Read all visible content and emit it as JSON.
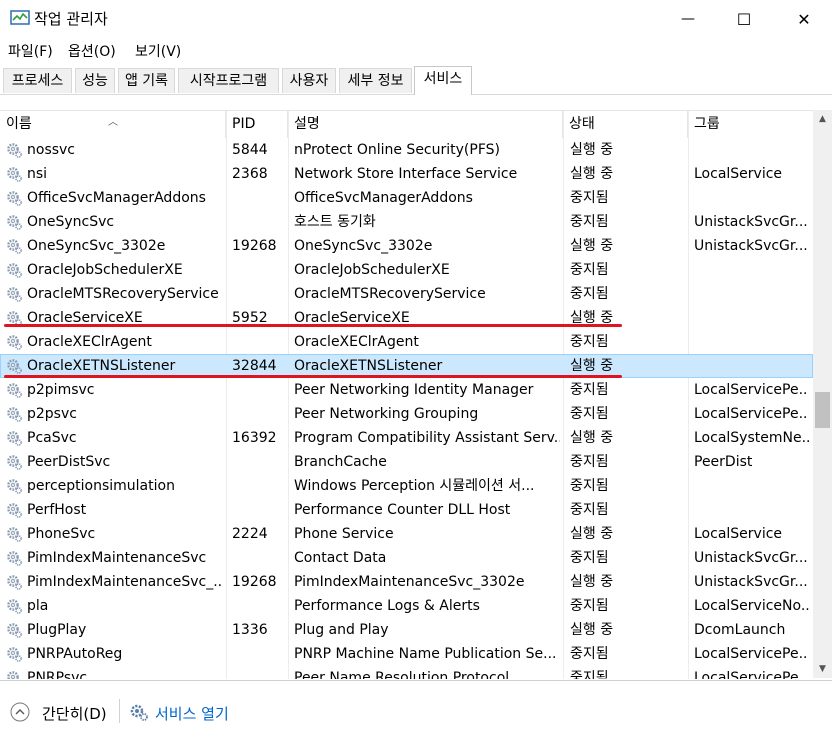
{
  "window": {
    "title": "작업 관리자",
    "minimize_glyph": "—",
    "maximize_glyph": "☐",
    "close_glyph": "✕"
  },
  "menu": [
    "파일(F)",
    "옵션(O)",
    "보기(V)"
  ],
  "tabs": [
    "프로세스",
    "성능",
    "앱 기록",
    "시작프로그램",
    "사용자",
    "세부 정보",
    "서비스"
  ],
  "active_tab": "서비스",
  "columns": {
    "name": "이름",
    "pid": "PID",
    "description": "설명",
    "status": "상태",
    "group": "그룹"
  },
  "rows": [
    {
      "name": "nossvc",
      "pid": "5844",
      "description": "nProtect Online Security(PFS)",
      "status": "실행 중",
      "group": ""
    },
    {
      "name": "nsi",
      "pid": "2368",
      "description": "Network Store Interface Service",
      "status": "실행 중",
      "group": "LocalService"
    },
    {
      "name": "OfficeSvcManagerAddons",
      "pid": "",
      "description": "OfficeSvcManagerAddons",
      "status": "중지됨",
      "group": ""
    },
    {
      "name": "OneSyncSvc",
      "pid": "",
      "description": "호스트 동기화",
      "status": "중지됨",
      "group": "UnistackSvcGr..."
    },
    {
      "name": "OneSyncSvc_3302e",
      "pid": "19268",
      "description": "OneSyncSvc_3302e",
      "status": "실행 중",
      "group": "UnistackSvcGr..."
    },
    {
      "name": "OracleJobSchedulerXE",
      "pid": "",
      "description": "OracleJobSchedulerXE",
      "status": "중지됨",
      "group": ""
    },
    {
      "name": "OracleMTSRecoveryService",
      "pid": "",
      "description": "OracleMTSRecoveryService",
      "status": "중지됨",
      "group": ""
    },
    {
      "name": "OracleServiceXE",
      "pid": "5952",
      "description": "OracleServiceXE",
      "status": "실행 중",
      "group": ""
    },
    {
      "name": "OracleXEClrAgent",
      "pid": "",
      "description": "OracleXEClrAgent",
      "status": "중지됨",
      "group": ""
    },
    {
      "name": "OracleXETNSListener",
      "pid": "32844",
      "description": "OracleXETNSListener",
      "status": "실행 중",
      "group": "",
      "selected": true
    },
    {
      "name": "p2pimsvc",
      "pid": "",
      "description": "Peer Networking Identity Manager",
      "status": "중지됨",
      "group": "LocalServicePe..."
    },
    {
      "name": "p2psvc",
      "pid": "",
      "description": "Peer Networking Grouping",
      "status": "중지됨",
      "group": "LocalServicePe..."
    },
    {
      "name": "PcaSvc",
      "pid": "16392",
      "description": "Program Compatibility Assistant Serv...",
      "status": "실행 중",
      "group": "LocalSystemNe..."
    },
    {
      "name": "PeerDistSvc",
      "pid": "",
      "description": "BranchCache",
      "status": "중지됨",
      "group": "PeerDist"
    },
    {
      "name": "perceptionsimulation",
      "pid": "",
      "description": "Windows Perception 시뮬레이션 서...",
      "status": "중지됨",
      "group": ""
    },
    {
      "name": "PerfHost",
      "pid": "",
      "description": "Performance Counter DLL Host",
      "status": "중지됨",
      "group": ""
    },
    {
      "name": "PhoneSvc",
      "pid": "2224",
      "description": "Phone Service",
      "status": "실행 중",
      "group": "LocalService"
    },
    {
      "name": "PimIndexMaintenanceSvc",
      "pid": "",
      "description": "Contact Data",
      "status": "중지됨",
      "group": "UnistackSvcGr..."
    },
    {
      "name": "PimIndexMaintenanceSvc_...",
      "pid": "19268",
      "description": "PimIndexMaintenanceSvc_3302e",
      "status": "실행 중",
      "group": "UnistackSvcGr..."
    },
    {
      "name": "pla",
      "pid": "",
      "description": "Performance Logs & Alerts",
      "status": "중지됨",
      "group": "LocalServiceNo..."
    },
    {
      "name": "PlugPlay",
      "pid": "1336",
      "description": "Plug and Play",
      "status": "실행 중",
      "group": "DcomLaunch"
    },
    {
      "name": "PNRPAutoReg",
      "pid": "",
      "description": "PNRP Machine Name Publication Se...",
      "status": "중지됨",
      "group": "LocalServicePe..."
    },
    {
      "name": "PNRPsvc",
      "pid": "",
      "description": "Peer Name Resolution Protocol",
      "status": "중지됨",
      "group": "LocalServicePe..."
    }
  ],
  "footer": {
    "collapse_label": "간단히(D)",
    "open_services_label": "서비스 열기"
  },
  "colors": {
    "selection_bg": "#cce8ff",
    "annotation_red": "#e0141e",
    "link_blue": "#0066cc"
  },
  "icons": [
    "task-manager-icon",
    "service-gear-icon",
    "chevron-up-icon",
    "services-icon"
  ]
}
